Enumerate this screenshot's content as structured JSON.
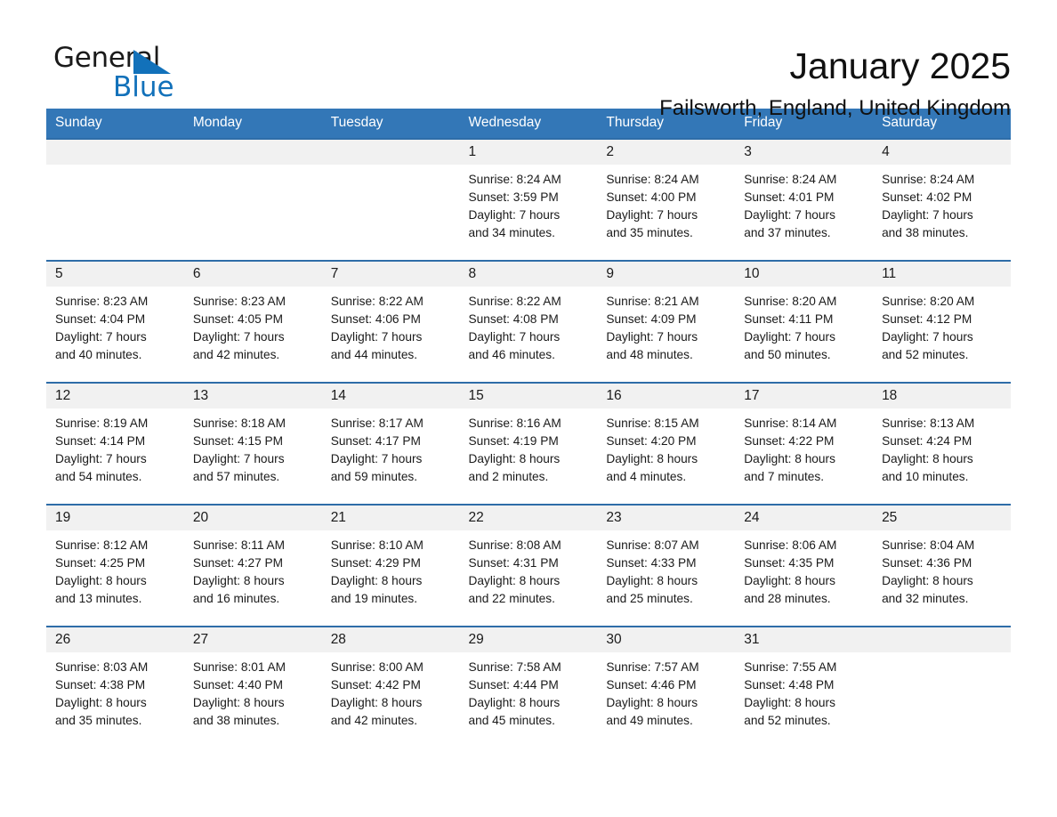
{
  "brand": {
    "name_part1": "General",
    "name_part2": "Blue",
    "accent_color": "#1271ba"
  },
  "header": {
    "title": "January 2025",
    "location": "Failsworth, England, United Kingdom"
  },
  "calendar": {
    "header_bg": "#3377b7",
    "row_divider_color": "#2e6da8",
    "daynum_bg": "#f1f1f1",
    "weekdays": [
      "Sunday",
      "Monday",
      "Tuesday",
      "Wednesday",
      "Thursday",
      "Friday",
      "Saturday"
    ],
    "weeks": [
      [
        {
          "day": "",
          "blank": true
        },
        {
          "day": "",
          "blank": true
        },
        {
          "day": "",
          "blank": true
        },
        {
          "day": "1",
          "sunrise": "Sunrise: 8:24 AM",
          "sunset": "Sunset: 3:59 PM",
          "daylight_line1": "Daylight: 7 hours",
          "daylight_line2": "and 34 minutes."
        },
        {
          "day": "2",
          "sunrise": "Sunrise: 8:24 AM",
          "sunset": "Sunset: 4:00 PM",
          "daylight_line1": "Daylight: 7 hours",
          "daylight_line2": "and 35 minutes."
        },
        {
          "day": "3",
          "sunrise": "Sunrise: 8:24 AM",
          "sunset": "Sunset: 4:01 PM",
          "daylight_line1": "Daylight: 7 hours",
          "daylight_line2": "and 37 minutes."
        },
        {
          "day": "4",
          "sunrise": "Sunrise: 8:24 AM",
          "sunset": "Sunset: 4:02 PM",
          "daylight_line1": "Daylight: 7 hours",
          "daylight_line2": "and 38 minutes."
        }
      ],
      [
        {
          "day": "5",
          "sunrise": "Sunrise: 8:23 AM",
          "sunset": "Sunset: 4:04 PM",
          "daylight_line1": "Daylight: 7 hours",
          "daylight_line2": "and 40 minutes."
        },
        {
          "day": "6",
          "sunrise": "Sunrise: 8:23 AM",
          "sunset": "Sunset: 4:05 PM",
          "daylight_line1": "Daylight: 7 hours",
          "daylight_line2": "and 42 minutes."
        },
        {
          "day": "7",
          "sunrise": "Sunrise: 8:22 AM",
          "sunset": "Sunset: 4:06 PM",
          "daylight_line1": "Daylight: 7 hours",
          "daylight_line2": "and 44 minutes."
        },
        {
          "day": "8",
          "sunrise": "Sunrise: 8:22 AM",
          "sunset": "Sunset: 4:08 PM",
          "daylight_line1": "Daylight: 7 hours",
          "daylight_line2": "and 46 minutes."
        },
        {
          "day": "9",
          "sunrise": "Sunrise: 8:21 AM",
          "sunset": "Sunset: 4:09 PM",
          "daylight_line1": "Daylight: 7 hours",
          "daylight_line2": "and 48 minutes."
        },
        {
          "day": "10",
          "sunrise": "Sunrise: 8:20 AM",
          "sunset": "Sunset: 4:11 PM",
          "daylight_line1": "Daylight: 7 hours",
          "daylight_line2": "and 50 minutes."
        },
        {
          "day": "11",
          "sunrise": "Sunrise: 8:20 AM",
          "sunset": "Sunset: 4:12 PM",
          "daylight_line1": "Daylight: 7 hours",
          "daylight_line2": "and 52 minutes."
        }
      ],
      [
        {
          "day": "12",
          "sunrise": "Sunrise: 8:19 AM",
          "sunset": "Sunset: 4:14 PM",
          "daylight_line1": "Daylight: 7 hours",
          "daylight_line2": "and 54 minutes."
        },
        {
          "day": "13",
          "sunrise": "Sunrise: 8:18 AM",
          "sunset": "Sunset: 4:15 PM",
          "daylight_line1": "Daylight: 7 hours",
          "daylight_line2": "and 57 minutes."
        },
        {
          "day": "14",
          "sunrise": "Sunrise: 8:17 AM",
          "sunset": "Sunset: 4:17 PM",
          "daylight_line1": "Daylight: 7 hours",
          "daylight_line2": "and 59 minutes."
        },
        {
          "day": "15",
          "sunrise": "Sunrise: 8:16 AM",
          "sunset": "Sunset: 4:19 PM",
          "daylight_line1": "Daylight: 8 hours",
          "daylight_line2": "and 2 minutes."
        },
        {
          "day": "16",
          "sunrise": "Sunrise: 8:15 AM",
          "sunset": "Sunset: 4:20 PM",
          "daylight_line1": "Daylight: 8 hours",
          "daylight_line2": "and 4 minutes."
        },
        {
          "day": "17",
          "sunrise": "Sunrise: 8:14 AM",
          "sunset": "Sunset: 4:22 PM",
          "daylight_line1": "Daylight: 8 hours",
          "daylight_line2": "and 7 minutes."
        },
        {
          "day": "18",
          "sunrise": "Sunrise: 8:13 AM",
          "sunset": "Sunset: 4:24 PM",
          "daylight_line1": "Daylight: 8 hours",
          "daylight_line2": "and 10 minutes."
        }
      ],
      [
        {
          "day": "19",
          "sunrise": "Sunrise: 8:12 AM",
          "sunset": "Sunset: 4:25 PM",
          "daylight_line1": "Daylight: 8 hours",
          "daylight_line2": "and 13 minutes."
        },
        {
          "day": "20",
          "sunrise": "Sunrise: 8:11 AM",
          "sunset": "Sunset: 4:27 PM",
          "daylight_line1": "Daylight: 8 hours",
          "daylight_line2": "and 16 minutes."
        },
        {
          "day": "21",
          "sunrise": "Sunrise: 8:10 AM",
          "sunset": "Sunset: 4:29 PM",
          "daylight_line1": "Daylight: 8 hours",
          "daylight_line2": "and 19 minutes."
        },
        {
          "day": "22",
          "sunrise": "Sunrise: 8:08 AM",
          "sunset": "Sunset: 4:31 PM",
          "daylight_line1": "Daylight: 8 hours",
          "daylight_line2": "and 22 minutes."
        },
        {
          "day": "23",
          "sunrise": "Sunrise: 8:07 AM",
          "sunset": "Sunset: 4:33 PM",
          "daylight_line1": "Daylight: 8 hours",
          "daylight_line2": "and 25 minutes."
        },
        {
          "day": "24",
          "sunrise": "Sunrise: 8:06 AM",
          "sunset": "Sunset: 4:35 PM",
          "daylight_line1": "Daylight: 8 hours",
          "daylight_line2": "and 28 minutes."
        },
        {
          "day": "25",
          "sunrise": "Sunrise: 8:04 AM",
          "sunset": "Sunset: 4:36 PM",
          "daylight_line1": "Daylight: 8 hours",
          "daylight_line2": "and 32 minutes."
        }
      ],
      [
        {
          "day": "26",
          "sunrise": "Sunrise: 8:03 AM",
          "sunset": "Sunset: 4:38 PM",
          "daylight_line1": "Daylight: 8 hours",
          "daylight_line2": "and 35 minutes."
        },
        {
          "day": "27",
          "sunrise": "Sunrise: 8:01 AM",
          "sunset": "Sunset: 4:40 PM",
          "daylight_line1": "Daylight: 8 hours",
          "daylight_line2": "and 38 minutes."
        },
        {
          "day": "28",
          "sunrise": "Sunrise: 8:00 AM",
          "sunset": "Sunset: 4:42 PM",
          "daylight_line1": "Daylight: 8 hours",
          "daylight_line2": "and 42 minutes."
        },
        {
          "day": "29",
          "sunrise": "Sunrise: 7:58 AM",
          "sunset": "Sunset: 4:44 PM",
          "daylight_line1": "Daylight: 8 hours",
          "daylight_line2": "and 45 minutes."
        },
        {
          "day": "30",
          "sunrise": "Sunrise: 7:57 AM",
          "sunset": "Sunset: 4:46 PM",
          "daylight_line1": "Daylight: 8 hours",
          "daylight_line2": "and 49 minutes."
        },
        {
          "day": "31",
          "sunrise": "Sunrise: 7:55 AM",
          "sunset": "Sunset: 4:48 PM",
          "daylight_line1": "Daylight: 8 hours",
          "daylight_line2": "and 52 minutes."
        },
        {
          "day": "",
          "blank": true
        }
      ]
    ]
  }
}
